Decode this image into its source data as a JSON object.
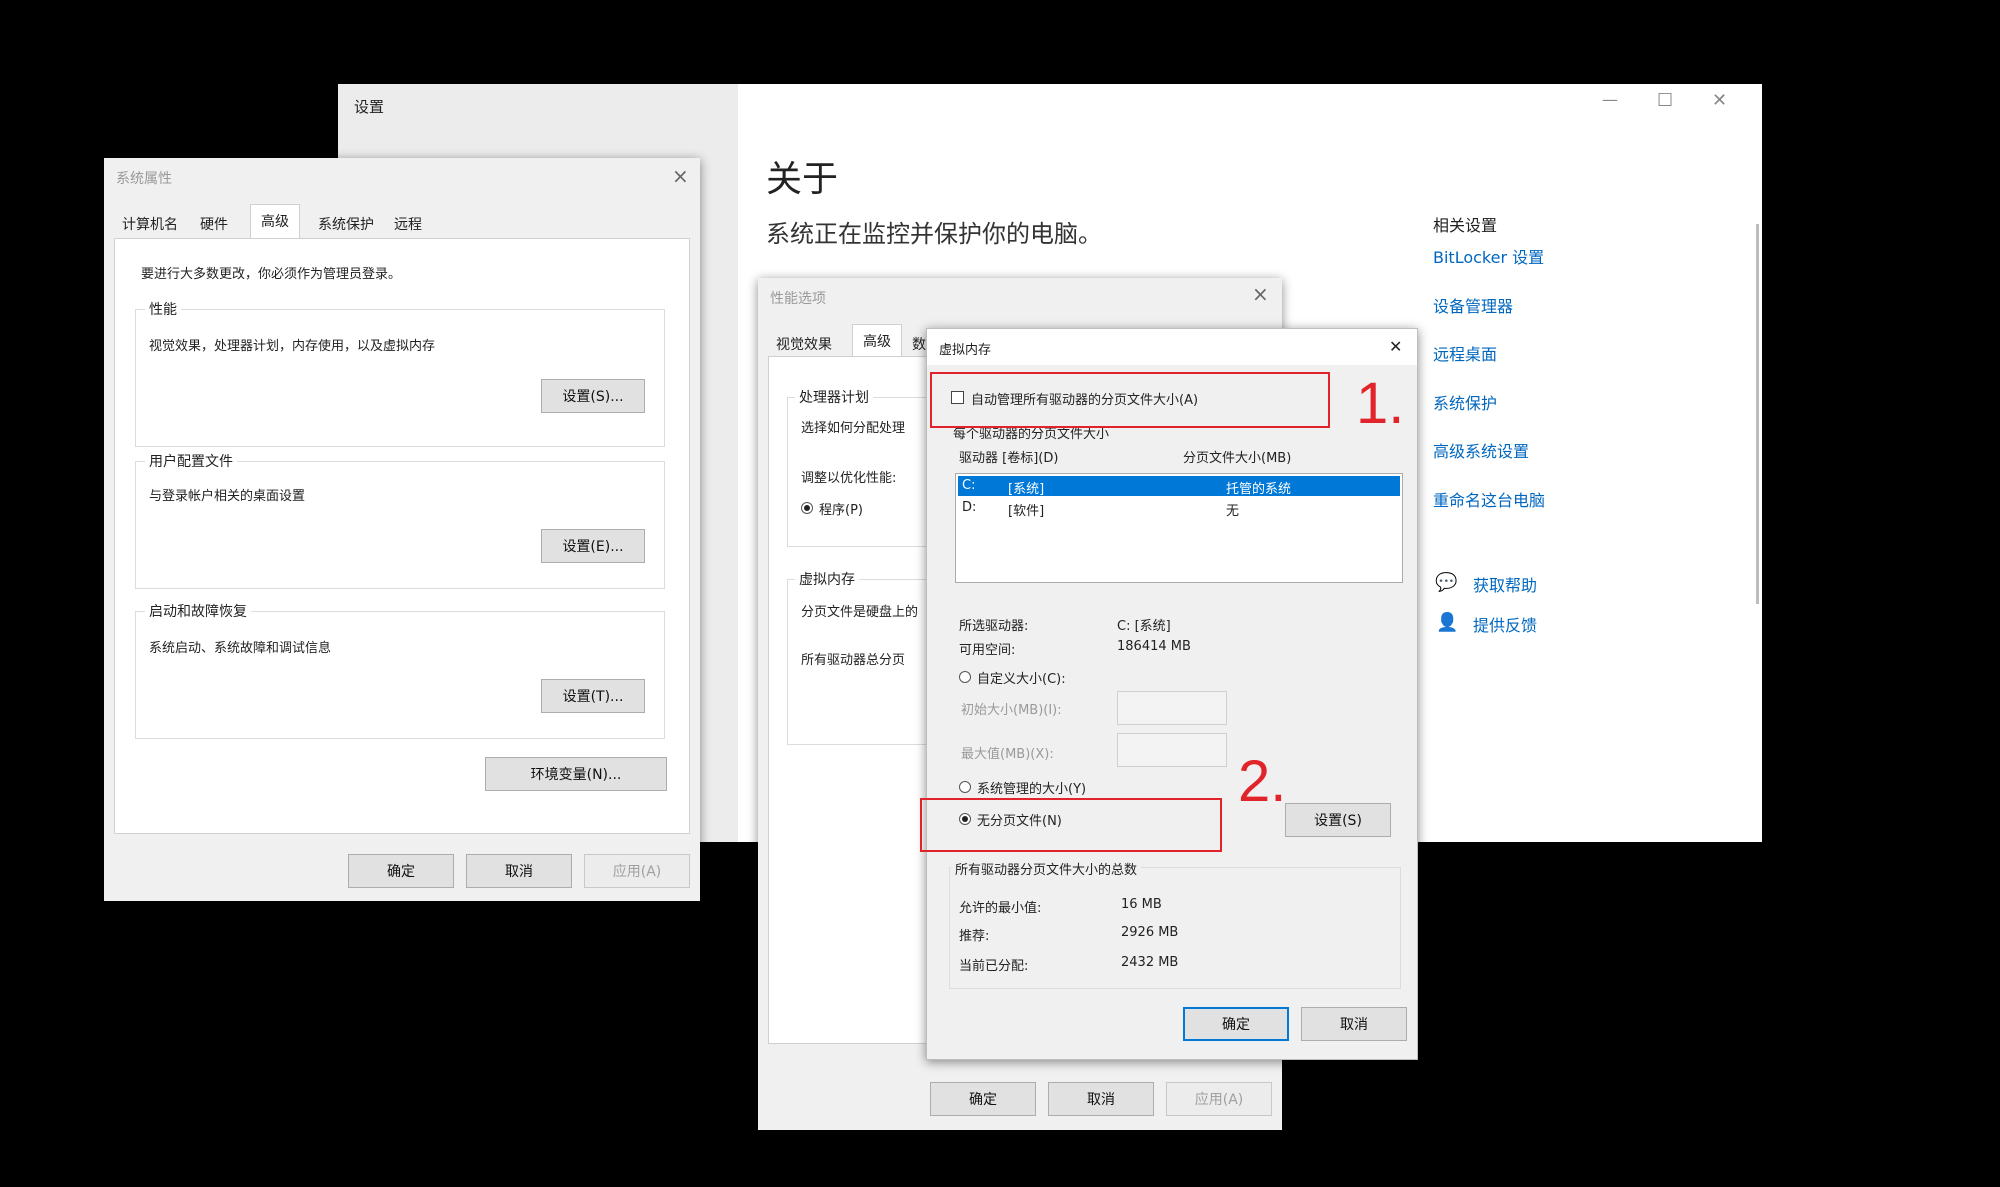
{
  "settings": {
    "title": "设置",
    "heading": "关于",
    "status": "系统正在监控并保护你的电脑。",
    "related_title": "相关设置",
    "links": [
      "BitLocker 设置",
      "设备管理器",
      "远程桌面",
      "系统保护",
      "高级系统设置",
      "重命名这台电脑"
    ],
    "help": "获取帮助",
    "feedback": "提供反馈",
    "controls": {
      "minimize": "—",
      "maximize": "☐",
      "close": "✕"
    }
  },
  "sysprops": {
    "title": "系统属性",
    "tabs": [
      "计算机名",
      "硬件",
      "高级",
      "系统保护",
      "远程"
    ],
    "admin_note": "要进行大多数更改，你必须作为管理员登录。",
    "performance": {
      "label": "性能",
      "desc": "视觉效果，处理器计划，内存使用，以及虚拟内存",
      "button": "设置(S)..."
    },
    "profile": {
      "label": "用户配置文件",
      "desc": "与登录帐户相关的桌面设置",
      "button": "设置(E)..."
    },
    "startup": {
      "label": "启动和故障恢复",
      "desc": "系统启动、系统故障和调试信息",
      "button": "设置(T)..."
    },
    "env_button": "环境变量(N)...",
    "ok": "确定",
    "cancel": "取消",
    "apply": "应用(A)"
  },
  "perf": {
    "title": "性能选项",
    "tabs": [
      "视觉效果",
      "高级",
      "数"
    ],
    "cpu_label": "处理器计划",
    "cpu_desc": "选择如何分配处理",
    "adjust_label": "调整以优化性能:",
    "programs": "程序(P)",
    "vm_label": "虚拟内存",
    "vm_desc": "分页文件是硬盘上的",
    "vm_total": "所有驱动器总分页",
    "ok": "确定",
    "cancel": "取消",
    "apply": "应用(A)"
  },
  "vmem": {
    "title": "虚拟内存",
    "auto_manage": "自动管理所有驱动器的分页文件大小(A)",
    "each_drive": "每个驱动器的分页文件大小",
    "col_drive": "驱动器 [卷标](D)",
    "col_size": "分页文件大小(MB)",
    "drives": [
      {
        "drive": "C:",
        "label": "[系统]",
        "size": "托管的系统"
      },
      {
        "drive": "D:",
        "label": "[软件]",
        "size": "无"
      }
    ],
    "selected_label": "所选驱动器:",
    "selected_value": "C: [系统]",
    "free_label": "可用空间:",
    "free_value": "186414 MB",
    "custom_size": "自定义大小(C):",
    "initial_size": "初始大小(MB)(I):",
    "max_size": "最大值(MB)(X):",
    "system_managed": "系统管理的大小(Y)",
    "no_paging": "无分页文件(N)",
    "set_button": "设置(S)",
    "totals_title": "所有驱动器分页文件大小的总数",
    "min_label": "允许的最小值:",
    "min_value": "16 MB",
    "rec_label": "推荐:",
    "rec_value": "2926 MB",
    "cur_label": "当前已分配:",
    "cur_value": "2432 MB",
    "ok": "确定",
    "cancel": "取消",
    "close": "✕"
  },
  "annotations": {
    "step1": "1.",
    "step2": "2."
  },
  "colors": {
    "accent": "#0078d7",
    "link": "#0067c0",
    "annotation": "#e0242a",
    "selection": "#0078d7"
  }
}
